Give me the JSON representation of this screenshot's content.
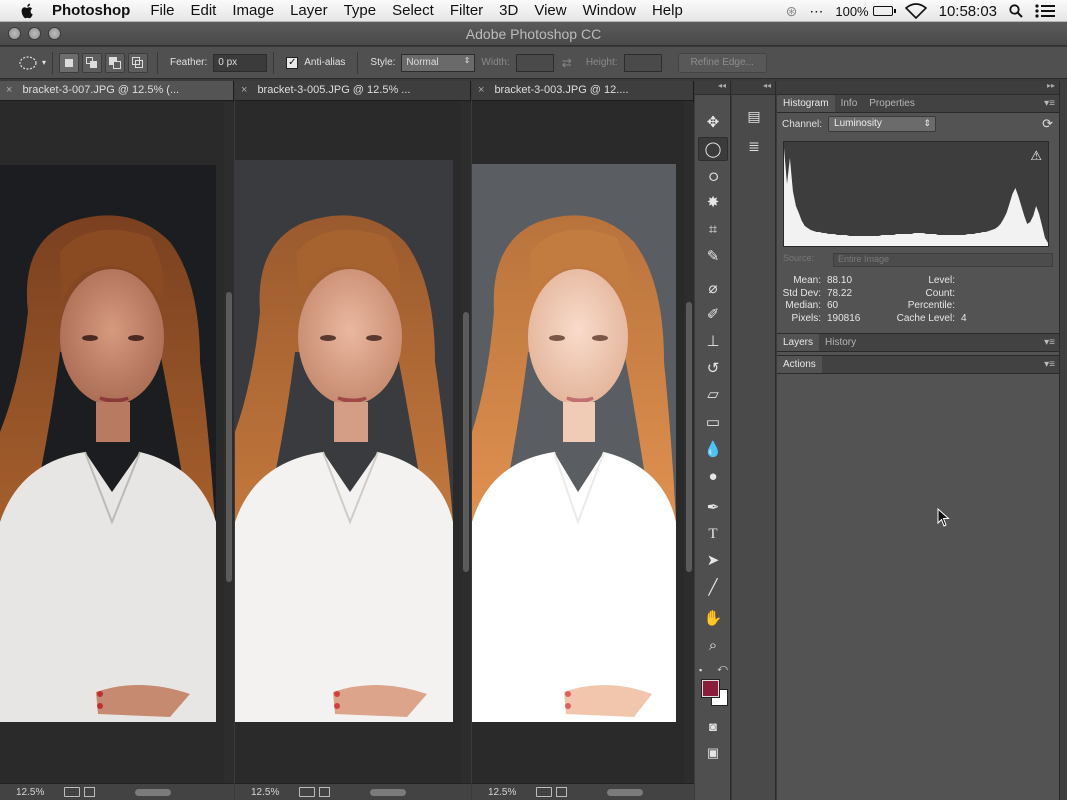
{
  "menubar": {
    "app": "Photoshop",
    "items": [
      "File",
      "Edit",
      "Image",
      "Layer",
      "Type",
      "Select",
      "Filter",
      "3D",
      "View",
      "Window",
      "Help"
    ],
    "battery": "100%",
    "clock": "10:58:03"
  },
  "window": {
    "title": "Adobe Photoshop CC"
  },
  "options": {
    "feather_label": "Feather:",
    "feather_value": "0 px",
    "antialias_label": "Anti-alias",
    "style_label": "Style:",
    "style_value": "Normal",
    "width_label": "Width:",
    "height_label": "Height:",
    "refine_label": "Refine Edge..."
  },
  "documents": [
    {
      "tab": "bracket-3-007.JPG @ 12.5% (...",
      "zoom": "12.5%"
    },
    {
      "tab": "bracket-3-005.JPG @ 12.5% ...",
      "zoom": "12.5%"
    },
    {
      "tab": "bracket-3-003.JPG @ 12....",
      "zoom": "12.5%"
    }
  ],
  "tools": [
    "move-tool",
    "elliptical-marquee-tool",
    "lasso-tool",
    "magic-wand-tool",
    "crop-tool",
    "eyedropper-tool",
    "spot-healing-tool",
    "brush-tool",
    "clone-stamp-tool",
    "history-brush-tool",
    "eraser-tool",
    "gradient-tool",
    "blur-tool",
    "dodge-tool",
    "pen-tool",
    "type-tool",
    "path-selection-tool",
    "line-tool",
    "hand-tool",
    "zoom-tool"
  ],
  "colors": {
    "foreground": "#8a1e3a",
    "background": "#ffffff",
    "accent": "#535353"
  },
  "histogram_panel": {
    "tabs": [
      "Histogram",
      "Info",
      "Properties"
    ],
    "channel_label": "Channel:",
    "channel_value": "Luminosity",
    "source_label": "Source:",
    "source_value": "Entire Image",
    "stats_left": [
      {
        "k": "Mean:",
        "v": "88.10"
      },
      {
        "k": "Std Dev:",
        "v": "78.22"
      },
      {
        "k": "Median:",
        "v": "60"
      },
      {
        "k": "Pixels:",
        "v": "190816"
      }
    ],
    "stats_right": [
      {
        "k": "Level:",
        "v": ""
      },
      {
        "k": "Count:",
        "v": ""
      },
      {
        "k": "Percentile:",
        "v": ""
      },
      {
        "k": "Cache Level:",
        "v": "4"
      }
    ],
    "histogram_levels": [
      98,
      62,
      88,
      55,
      40,
      33,
      25,
      20,
      18,
      16,
      15,
      14,
      14,
      13,
      13,
      12,
      12,
      12,
      11,
      11,
      11,
      11,
      10,
      10,
      10,
      10,
      10,
      10,
      10,
      10,
      10,
      10,
      10,
      11,
      11,
      11,
      11,
      11,
      12,
      12,
      12,
      12,
      12,
      12,
      13,
      13,
      13,
      13,
      12,
      12,
      12,
      12,
      11,
      11,
      11,
      11,
      11,
      11,
      11,
      11,
      11,
      11,
      12,
      12,
      12,
      13,
      13,
      14,
      14,
      15,
      16,
      17,
      19,
      22,
      27,
      33,
      42,
      52,
      58,
      50,
      40,
      30,
      22,
      24,
      30,
      40,
      32,
      20,
      8,
      3
    ]
  },
  "layers_panel": {
    "tabs": [
      "Layers",
      "History"
    ]
  },
  "actions_panel": {
    "tabs": [
      "Actions"
    ]
  }
}
